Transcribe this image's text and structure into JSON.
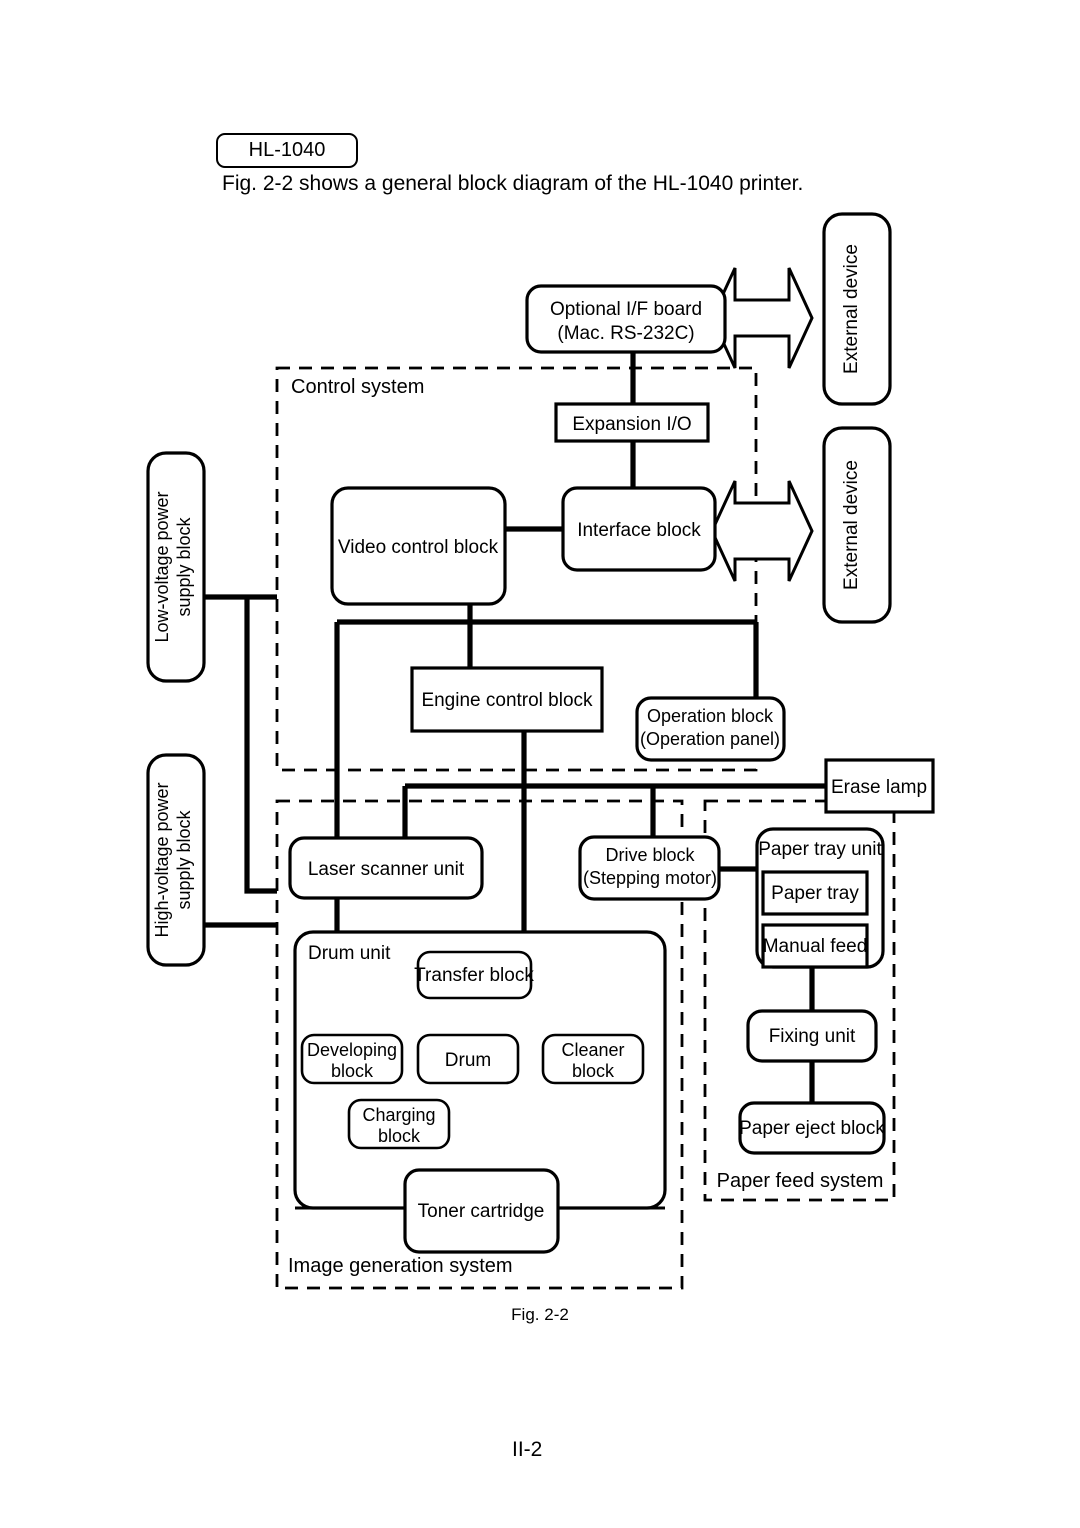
{
  "document": {
    "model_tag": "HL-1040",
    "caption": "Fig. 2-2 shows a general block diagram of the HL-1040 printer.",
    "figure_label": "Fig. 2-2",
    "page_number": "II-2"
  },
  "groups": {
    "control_system": "Control system",
    "image_generation_system": "Image generation system",
    "paper_feed_system": "Paper feed system",
    "drum_unit": "Drum unit",
    "paper_tray_unit": "Paper tray unit"
  },
  "blocks": {
    "optional_if_board_line1": "Optional I/F board",
    "optional_if_board_line2": "(Mac. RS-232C)",
    "external_device_top": "External device",
    "external_device_bottom": "External device",
    "expansion_io": "Expansion I/O",
    "interface_block": "Interface block",
    "video_control_block": "Video control block",
    "engine_control_block": "Engine control block",
    "operation_block_line1": "Operation block",
    "operation_block_line2": "(Operation  panel)",
    "low_voltage_line1": "Low-voltage power",
    "low_voltage_line2": "supply block",
    "high_voltage_line1": "High-voltage power",
    "high_voltage_line2": "supply block",
    "erase_lamp": "Erase lamp",
    "laser_scanner_unit": "Laser scanner unit",
    "drive_block_line1": "Drive block",
    "drive_block_line2": "(Stepping motor)",
    "transfer_block": "Transfer block",
    "developing_block_line1": "Developing",
    "developing_block_line2": "block",
    "drum": "Drum",
    "cleaner_block_line1": "Cleaner",
    "cleaner_block_line2": "block",
    "charging_block_line1": "Charging",
    "charging_block_line2": "block",
    "toner_cartridge": "Toner cartridge",
    "paper_tray": "Paper tray",
    "manual_feed": "Manual feed",
    "fixing_unit": "Fixing unit",
    "paper_eject_block": "Paper eject block"
  },
  "colors": {
    "ink": "#000000",
    "paper": "#ffffff"
  }
}
